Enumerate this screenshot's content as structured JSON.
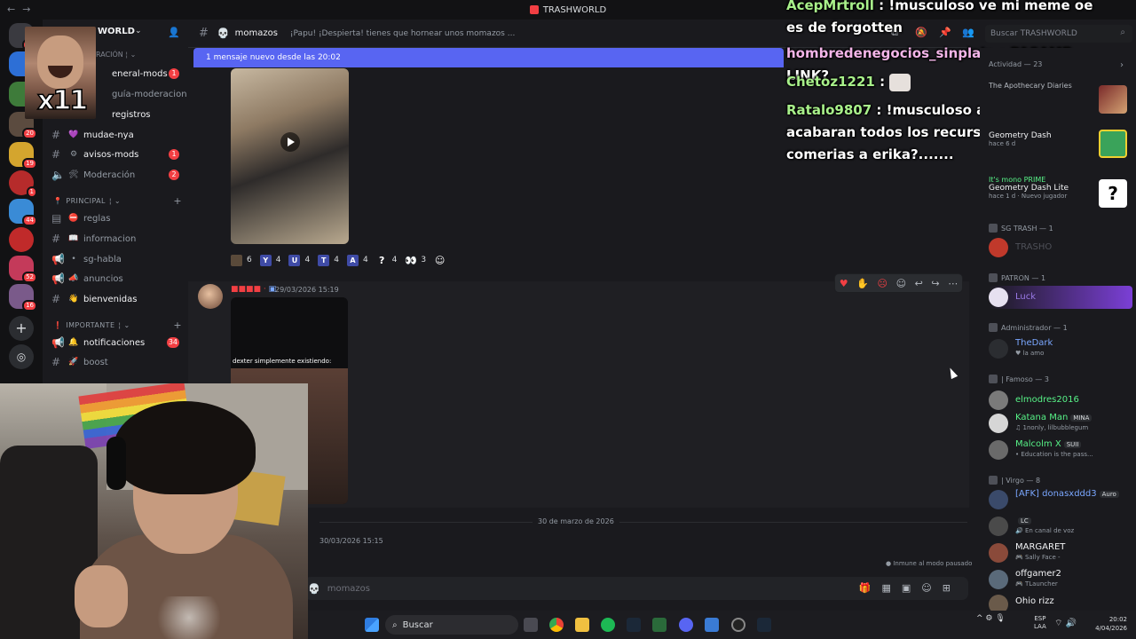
{
  "window": {
    "title": "TRASHWORLD"
  },
  "server": {
    "name": "WORLD"
  },
  "overlay": {
    "meme_label": "x11"
  },
  "channels": {
    "items": [
      {
        "label": "eneral-mods",
        "count": "1",
        "unread": true
      },
      {
        "label": "guía-moderacion",
        "count": "",
        "unread": false
      },
      {
        "label": "registros",
        "count": "",
        "unread": true
      },
      {
        "label": "mudae-nya",
        "count": "",
        "unread": true
      },
      {
        "label": "avisos-mods",
        "count": "1",
        "unread": true
      },
      {
        "label": "Moderación",
        "count": "2",
        "unread": false
      }
    ],
    "principal_label": "PRINCIPAL",
    "principal_items": [
      {
        "label": "reglas"
      },
      {
        "label": "informacion"
      },
      {
        "label": "sg-habla"
      },
      {
        "label": "anuncios"
      },
      {
        "label": "bienvenidas"
      }
    ],
    "importante_label": "IMPORTANTE",
    "importante_items": [
      {
        "label": "notificaciones",
        "count": "34"
      },
      {
        "label": "boost",
        "count": ""
      }
    ]
  },
  "header": {
    "channel_name": "momazos",
    "topic": "¡Papu! ¡Despierta! tienes que hornear unos momazos ...",
    "new_messages": "1 mensaje nuevo desde las 20:02",
    "search_placeholder": "Buscar TRASHWORLD"
  },
  "reactions": [
    {
      "key": "",
      "count": "6"
    },
    {
      "key": "Y",
      "count": "4"
    },
    {
      "key": "U",
      "count": "4"
    },
    {
      "key": "T",
      "count": "4"
    },
    {
      "key": "A",
      "count": "4"
    },
    {
      "key": "?",
      "count": "4"
    },
    {
      "key": "👀",
      "count": "3"
    }
  ],
  "message2": {
    "time": "29/03/2026 15:19",
    "video_caption": "dexter simplemente existiendo:"
  },
  "divider": "30 de marzo de 2026",
  "message3": {
    "time": "30/03/2026 15:15"
  },
  "paused": "Inmune al modo pausado",
  "composer": {
    "placeholder": "momazos"
  },
  "chat": [
    {
      "user": "AcepMrtroll",
      "text": ": !musculoso ve mi meme oe es de forgotten",
      "color": "#a8f08a"
    },
    {
      "user": "hombredenegocios_sinplata",
      "text": ": PASAME LINK?",
      "color": "#f3b5e8"
    },
    {
      "user": "Chetoz1221",
      "text": ":",
      "color": "#a8f08a"
    },
    {
      "user": "Ratalo9807",
      "text": ": !musculoso angel si se acabaran todos los recursos del mundo te comerias a erika?.......",
      "color": "#a8f08a"
    }
  ],
  "members": {
    "activity_header": "Actividad — 23",
    "activities": [
      {
        "line1": "",
        "line2": "The Apothecary Diaries",
        "line3": ""
      },
      {
        "line1": "",
        "line2": "Geometry Dash",
        "line3": "hace 6 d"
      },
      {
        "line1": "It's mono PRIME",
        "line2": "Geometry Dash Lite",
        "line3": "hace 1 d · Nuevo jugador"
      }
    ],
    "groups": [
      {
        "label": "SG TRASH — 1",
        "members": [
          {
            "name": "TRASHO",
            "status": "",
            "color": "#4e5058",
            "tag": ""
          }
        ]
      },
      {
        "label": "PATRON — 1",
        "members": [
          {
            "name": "Luck",
            "status": "",
            "color": "#6c4bd6",
            "tag": ""
          }
        ]
      },
      {
        "label": "Administrador — 1",
        "members": [
          {
            "name": "TheDark",
            "status": "la amo",
            "color": "#7aa7ff",
            "tag": ""
          }
        ]
      },
      {
        "label": "| Famoso — 3",
        "members": [
          {
            "name": "elmodres2016",
            "status": "",
            "color": "#57f287",
            "tag": ""
          },
          {
            "name": "Katana Man",
            "status": "1nonly, lilbubblegum",
            "color": "#57f287",
            "tag": "MINA"
          },
          {
            "name": "Malcolm X",
            "status": "Education is the pass...",
            "color": "#57f287",
            "tag": "SUII"
          }
        ]
      },
      {
        "label": "| Virgo — 8",
        "members": [
          {
            "name": "[AFK] donasxddd3",
            "status": "",
            "color": "#7aa7ff",
            "tag": "Auro"
          },
          {
            "name": "",
            "status": "En canal de voz",
            "color": "#7aa7ff",
            "tag": "LC"
          },
          {
            "name": "MARGARET",
            "status": "Sally Face -",
            "color": "#f2f3f5",
            "tag": ""
          },
          {
            "name": "offgamer2",
            "status": "TLauncher",
            "color": "#f2f3f5",
            "tag": ""
          },
          {
            "name": "Ohio rizz",
            "status": "",
            "color": "#f2f3f5",
            "tag": ""
          }
        ]
      }
    ]
  },
  "taskbar": {
    "search": "Buscar",
    "lang": "ESP",
    "lang2": "LAA",
    "time": "20:02",
    "date": "4/04/2026"
  },
  "rail_badges": [
    "72",
    "20",
    "19",
    "1",
    "44",
    "52",
    "16"
  ]
}
